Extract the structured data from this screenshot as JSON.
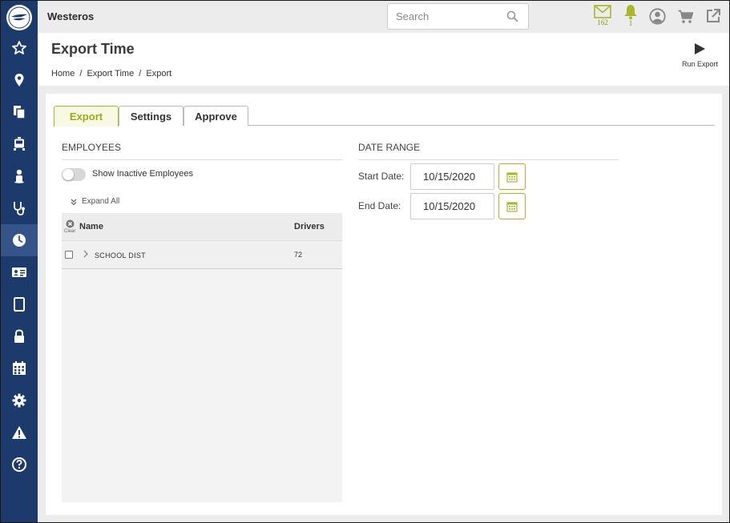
{
  "app": {
    "name": "Westeros"
  },
  "search": {
    "placeholder": "Search"
  },
  "topbar": {
    "mail": {
      "icon": "mail-icon",
      "count": "162"
    },
    "notifications": {
      "icon": "bell-icon",
      "count": "1"
    },
    "user_icon": "user-circle-icon",
    "cart_icon": "cart-icon",
    "external_icon": "external-link-icon",
    "accent_color": "#a8b82a"
  },
  "header": {
    "title": "Export Time",
    "breadcrumb": [
      "Home",
      "/",
      "Export Time",
      "/",
      "Export"
    ],
    "run_export_label": "Run Export"
  },
  "sidebar": {
    "color": "#1d3a6c",
    "active_color": "#35558a",
    "items": [
      {
        "icon": "star-icon"
      },
      {
        "icon": "map-pin-icon"
      },
      {
        "icon": "documents-icon"
      },
      {
        "icon": "bus-icon"
      },
      {
        "icon": "person-icon"
      },
      {
        "icon": "stethoscope-icon"
      },
      {
        "icon": "clock-icon",
        "active": true
      },
      {
        "icon": "id-card-icon"
      },
      {
        "icon": "tablet-icon"
      },
      {
        "icon": "lock-icon"
      },
      {
        "icon": "calendar-icon"
      },
      {
        "icon": "gear-icon"
      },
      {
        "icon": "warning-icon"
      },
      {
        "icon": "help-icon"
      }
    ]
  },
  "tabs": [
    {
      "label": "Export",
      "active": true
    },
    {
      "label": "Settings",
      "active": false
    },
    {
      "label": "Approve",
      "active": false
    }
  ],
  "employees": {
    "title": "EMPLOYEES",
    "show_inactive_label": "Show Inactive Employees",
    "show_inactive": false,
    "expand_all_label": "Expand All",
    "clear_label": "Clear",
    "columns": {
      "name": "Name",
      "drivers": "Drivers"
    },
    "rows": [
      {
        "name": "SCHOOL DIST",
        "drivers": "72"
      }
    ]
  },
  "date_range": {
    "title": "DATE RANGE",
    "start_label": "Start Date:",
    "start_value": "10/15/2020",
    "end_label": "End Date:",
    "end_value": "10/15/2020"
  }
}
